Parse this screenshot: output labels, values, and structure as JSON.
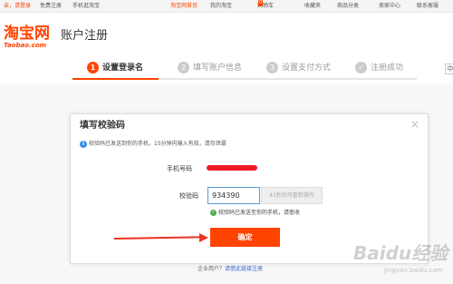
{
  "topbar": {
    "login_prompt": "亲，请登录",
    "register": "免费注册",
    "mobile": "手机逛淘宝",
    "home": "淘宝网首页",
    "my_taobao": "我的淘宝",
    "cart": "购物车",
    "cart_count": "0",
    "favorites": "收藏夹",
    "categories": "商品分类",
    "seller_center": "卖家中心",
    "service": "联系客服"
  },
  "logo": {
    "main": "淘宝网",
    "sub": "Taobao.com"
  },
  "page_title": "账户注册",
  "steps": [
    {
      "num": "1",
      "label": "设置登录名"
    },
    {
      "num": "2",
      "label": "填写账户信息"
    },
    {
      "num": "3",
      "label": "设置支付方式"
    },
    {
      "num": "✓",
      "label": "注册成功"
    }
  ],
  "lang_box": "中",
  "dialog": {
    "title": "填写校验码",
    "close": "×",
    "notice": "校验码已发送到你的手机，15分钟内输入有效，请勿泄漏",
    "phone_label": "手机号码",
    "phone_value": "",
    "code_label": "校验码",
    "code_value": "934390",
    "resend": "41秒后可重新操作",
    "sent_tip": "校验码已发送至你的手机，请查收",
    "confirm": "确定"
  },
  "enterprise": {
    "prefix": "企业用户？",
    "link": "请借此链接注册"
  },
  "watermark": {
    "main": "Baidu经验",
    "sub": "jingyan.baidu.com"
  },
  "colors": {
    "brand": "#ff4400",
    "info": "#3a8ee6",
    "success": "#4caf50",
    "annotation": "#ee3322"
  }
}
